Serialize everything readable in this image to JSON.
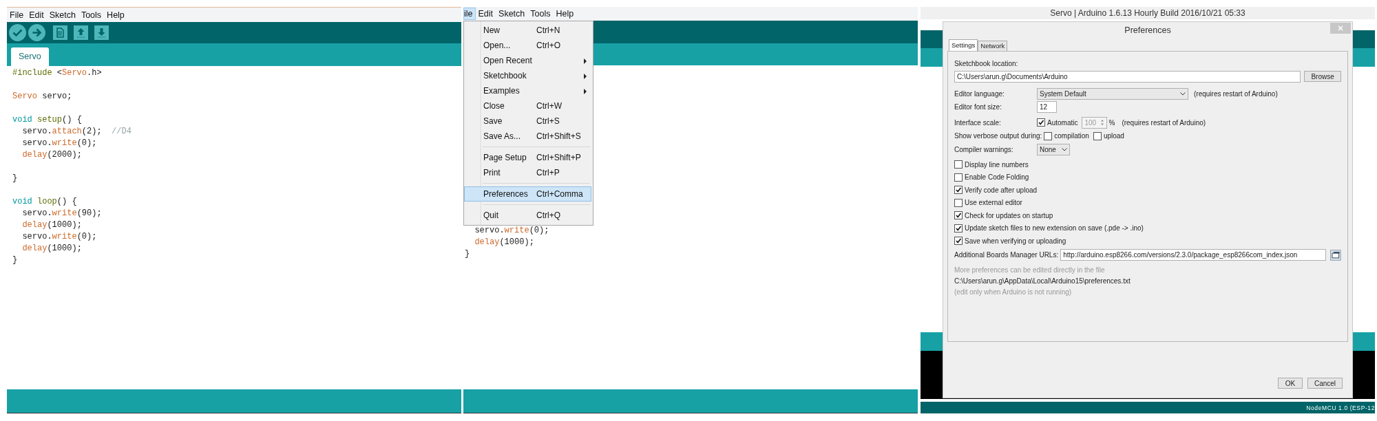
{
  "editor_window": {
    "menu_bar": [
      "File",
      "Edit",
      "Sketch",
      "Tools",
      "Help"
    ],
    "tabs": [
      {
        "label": "Servo",
        "selected": true
      }
    ],
    "code": [
      {
        "kind": "code",
        "tokens": [
          {
            "text": "#include",
            "kind": "preproc"
          },
          {
            "text": " <",
            "kind": "plain"
          },
          {
            "text": "Servo",
            "kind": "type"
          },
          {
            "text": ".h>",
            "kind": "plain"
          }
        ]
      },
      {
        "kind": "blank"
      },
      {
        "kind": "code",
        "tokens": [
          {
            "text": "Servo",
            "kind": "type"
          },
          {
            "text": " servo;",
            "kind": "plain"
          }
        ]
      },
      {
        "kind": "blank"
      },
      {
        "kind": "code",
        "tokens": [
          {
            "text": "void",
            "kind": "keyword"
          },
          {
            "text": " setup",
            "kind": "function"
          },
          {
            "text": "() {",
            "kind": "plain"
          }
        ]
      },
      {
        "kind": "code",
        "tokens": [
          {
            "text": "  servo.",
            "kind": "plain"
          },
          {
            "text": "attach",
            "kind": "method"
          },
          {
            "text": "(2);  ",
            "kind": "plain"
          },
          {
            "text": "//D4",
            "kind": "comment"
          }
        ]
      },
      {
        "kind": "code",
        "tokens": [
          {
            "text": "  servo.",
            "kind": "plain"
          },
          {
            "text": "write",
            "kind": "method"
          },
          {
            "text": "(0);",
            "kind": "plain"
          }
        ]
      },
      {
        "kind": "code",
        "tokens": [
          {
            "text": "  delay",
            "kind": "method"
          },
          {
            "text": "(2000);",
            "kind": "plain"
          }
        ]
      },
      {
        "kind": "blank"
      },
      {
        "kind": "code",
        "tokens": [
          {
            "text": "}",
            "kind": "plain"
          }
        ]
      },
      {
        "kind": "blank"
      },
      {
        "kind": "code",
        "tokens": [
          {
            "text": "void",
            "kind": "keyword"
          },
          {
            "text": " loop",
            "kind": "function"
          },
          {
            "text": "() {",
            "kind": "plain"
          }
        ]
      },
      {
        "kind": "code",
        "tokens": [
          {
            "text": "  servo.",
            "kind": "plain"
          },
          {
            "text": "write",
            "kind": "method"
          },
          {
            "text": "(90);",
            "kind": "plain"
          }
        ]
      },
      {
        "kind": "code",
        "tokens": [
          {
            "text": "  delay",
            "kind": "method"
          },
          {
            "text": "(1000);",
            "kind": "plain"
          }
        ]
      },
      {
        "kind": "code",
        "tokens": [
          {
            "text": "  servo.",
            "kind": "plain"
          },
          {
            "text": "write",
            "kind": "method"
          },
          {
            "text": "(0);",
            "kind": "plain"
          }
        ]
      },
      {
        "kind": "code",
        "tokens": [
          {
            "text": "  delay",
            "kind": "method"
          },
          {
            "text": "(1000);",
            "kind": "plain"
          }
        ]
      },
      {
        "kind": "code",
        "tokens": [
          {
            "text": "}",
            "kind": "plain"
          }
        ]
      }
    ]
  },
  "menu_window": {
    "menu_bar": [
      {
        "label": "ile",
        "selected": true
      },
      {
        "label": "Edit",
        "selected": false
      },
      {
        "label": "Sketch",
        "selected": false
      },
      {
        "label": "Tools",
        "selected": false
      },
      {
        "label": "Help",
        "selected": false
      }
    ],
    "file_menu": [
      {
        "kind": "item",
        "label": "New",
        "shortcut": "Ctrl+N",
        "selected": false
      },
      {
        "kind": "item",
        "label": "Open...",
        "shortcut": "Ctrl+O",
        "selected": false
      },
      {
        "kind": "submenu",
        "label": "Open Recent",
        "selected": false
      },
      {
        "kind": "submenu",
        "label": "Sketchbook",
        "selected": false
      },
      {
        "kind": "submenu",
        "label": "Examples",
        "selected": false
      },
      {
        "kind": "item",
        "label": "Close",
        "shortcut": "Ctrl+W",
        "selected": false
      },
      {
        "kind": "item",
        "label": "Save",
        "shortcut": "Ctrl+S",
        "selected": false
      },
      {
        "kind": "item",
        "label": "Save As...",
        "shortcut": "Ctrl+Shift+S",
        "selected": false
      },
      {
        "kind": "separator"
      },
      {
        "kind": "item",
        "label": "Page Setup",
        "shortcut": "Ctrl+Shift+P",
        "selected": false
      },
      {
        "kind": "item",
        "label": "Print",
        "shortcut": "Ctrl+P",
        "selected": false
      },
      {
        "kind": "separator"
      },
      {
        "kind": "item",
        "label": "Preferences",
        "shortcut": "Ctrl+Comma",
        "selected": true
      },
      {
        "kind": "separator"
      },
      {
        "kind": "item",
        "label": "Quit",
        "shortcut": "Ctrl+Q",
        "selected": false
      }
    ],
    "code": [
      {
        "kind": "code",
        "tokens": [
          {
            "text": "  servo.",
            "kind": "plain"
          },
          {
            "text": "write",
            "kind": "method"
          },
          {
            "text": "(0);",
            "kind": "plain"
          }
        ]
      },
      {
        "kind": "code",
        "tokens": [
          {
            "text": "  delay",
            "kind": "method"
          },
          {
            "text": "(1000);",
            "kind": "plain"
          }
        ]
      },
      {
        "kind": "code",
        "tokens": [
          {
            "text": "}",
            "kind": "plain"
          }
        ]
      }
    ]
  },
  "preferences_window": {
    "title": "Servo | Arduino 1.6.13 Hourly Build 2016/10/21 05:33",
    "dialog": {
      "title": "Preferences",
      "tabs": [
        {
          "label": "Settings",
          "selected": true
        },
        {
          "label": "Network",
          "selected": false
        }
      ],
      "sketchbook_location": {
        "label": "Sketchbook location:",
        "value": "C:\\Users\\arun.g\\Documents\\Arduino",
        "button": "Browse"
      },
      "editor_language": {
        "label": "Editor language:",
        "value": "System Default",
        "note": "(requires restart of Arduino)"
      },
      "editor_font_size": {
        "label": "Editor font size:",
        "value": "12"
      },
      "interface_scale": {
        "label": "Interface scale:",
        "checkbox_label": "Automatic",
        "checked": true,
        "value": "100",
        "unit": "%",
        "note": "(requires restart of Arduino)"
      },
      "verbose_output": {
        "label": "Show verbose output during:",
        "options": [
          {
            "label": "compilation",
            "checked": false
          },
          {
            "label": "upload",
            "checked": false
          }
        ]
      },
      "compiler_warnings": {
        "label": "Compiler warnings:",
        "value": "None"
      },
      "options": [
        {
          "label": "Display line numbers",
          "checked": false
        },
        {
          "label": "Enable Code Folding",
          "checked": false
        },
        {
          "label": "Verify code after upload",
          "checked": true
        },
        {
          "label": "Use external editor",
          "checked": false
        },
        {
          "label": "Check for updates on startup",
          "checked": true
        },
        {
          "label": "Update sketch files to new extension on save (.pde -> .ino)",
          "checked": true
        },
        {
          "label": "Save when verifying or uploading",
          "checked": true
        }
      ],
      "boards_manager_urls": {
        "label": "Additional Boards Manager URLs:",
        "value": "http://arduino.esp8266.com/versions/2.3.0/package_esp8266com_index.json"
      },
      "more_info": "More preferences can be edited directly in the file",
      "preferences_path": "C:\\Users\\arun.g\\AppData\\Local\\Arduino15\\preferences.txt",
      "edit_note": "(edit only when Arduino is not running)",
      "buttons": [
        "OK",
        "Cancel"
      ]
    },
    "status_bar": "NodeMCU 1.0 (ESP-12"
  }
}
